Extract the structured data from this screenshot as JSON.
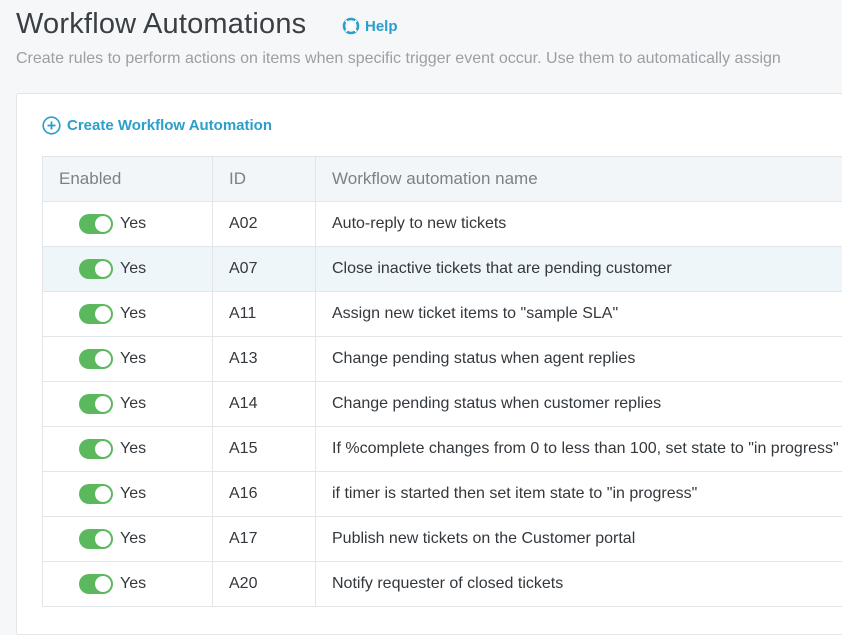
{
  "header": {
    "title": "Workflow Automations",
    "help_label": "Help",
    "subtitle": "Create rules to perform actions on items when specific trigger event occur. Use them to automatically assign"
  },
  "create_label": "Create Workflow Automation",
  "colors": {
    "accent": "#2a9fc9",
    "toggle_on": "#5cb85c"
  },
  "table": {
    "columns": [
      "Enabled",
      "ID",
      "Workflow automation name"
    ],
    "rows": [
      {
        "enabled": "Yes",
        "id": "A02",
        "name": "Auto-reply to new tickets"
      },
      {
        "enabled": "Yes",
        "id": "A07",
        "name": "Close inactive tickets that are pending customer"
      },
      {
        "enabled": "Yes",
        "id": "A11",
        "name": "Assign new ticket items to \"sample SLA\""
      },
      {
        "enabled": "Yes",
        "id": "A13",
        "name": "Change pending status when agent replies"
      },
      {
        "enabled": "Yes",
        "id": "A14",
        "name": "Change pending status when customer replies"
      },
      {
        "enabled": "Yes",
        "id": "A15",
        "name": "If %complete changes from 0 to less than 100, set state to \"in progress\""
      },
      {
        "enabled": "Yes",
        "id": "A16",
        "name": "if timer is started then set item state to \"in progress\""
      },
      {
        "enabled": "Yes",
        "id": "A17",
        "name": "Publish new tickets on the Customer portal"
      },
      {
        "enabled": "Yes",
        "id": "A20",
        "name": "Notify requester of closed tickets"
      }
    ]
  }
}
